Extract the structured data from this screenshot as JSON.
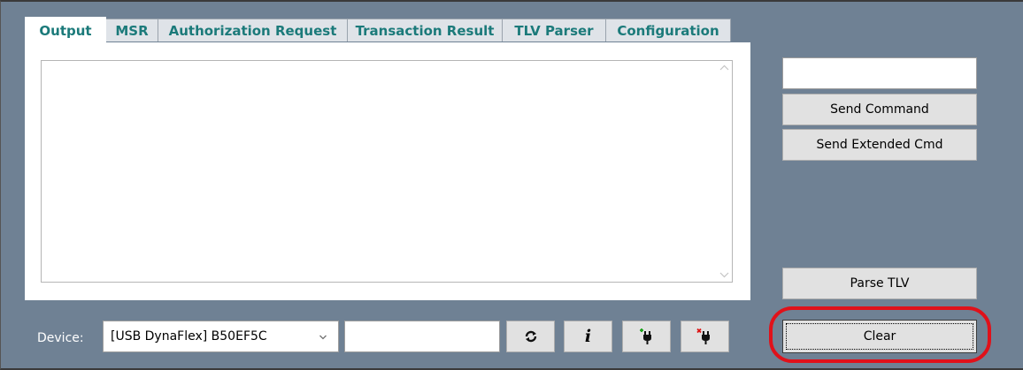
{
  "tabs": [
    {
      "label": "Output",
      "active": true
    },
    {
      "label": "MSR",
      "active": false
    },
    {
      "label": "Authorization Request",
      "active": false
    },
    {
      "label": "Transaction Result",
      "active": false
    },
    {
      "label": "TLV Parser",
      "active": false
    },
    {
      "label": "Configuration",
      "active": false
    }
  ],
  "output": {
    "value": ""
  },
  "command": {
    "value": "",
    "send_label": "Send Command",
    "send_ext_label": "Send Extended Cmd"
  },
  "parse_tlv_label": "Parse TLV",
  "clear_label": "Clear",
  "device": {
    "label": "Device:",
    "selected": "[USB DynaFlex] B50EF5C",
    "aux_input_value": ""
  },
  "icons": {
    "refresh": "refresh-icon",
    "info": "info-icon",
    "connect": "plug-connect-icon",
    "disconnect": "plug-disconnect-icon",
    "dropdown": "chevron-down-icon"
  },
  "colors": {
    "background": "#6f8194",
    "tab_text": "#1b7a7a",
    "highlight": "#e0111a"
  },
  "info_glyph": "i"
}
